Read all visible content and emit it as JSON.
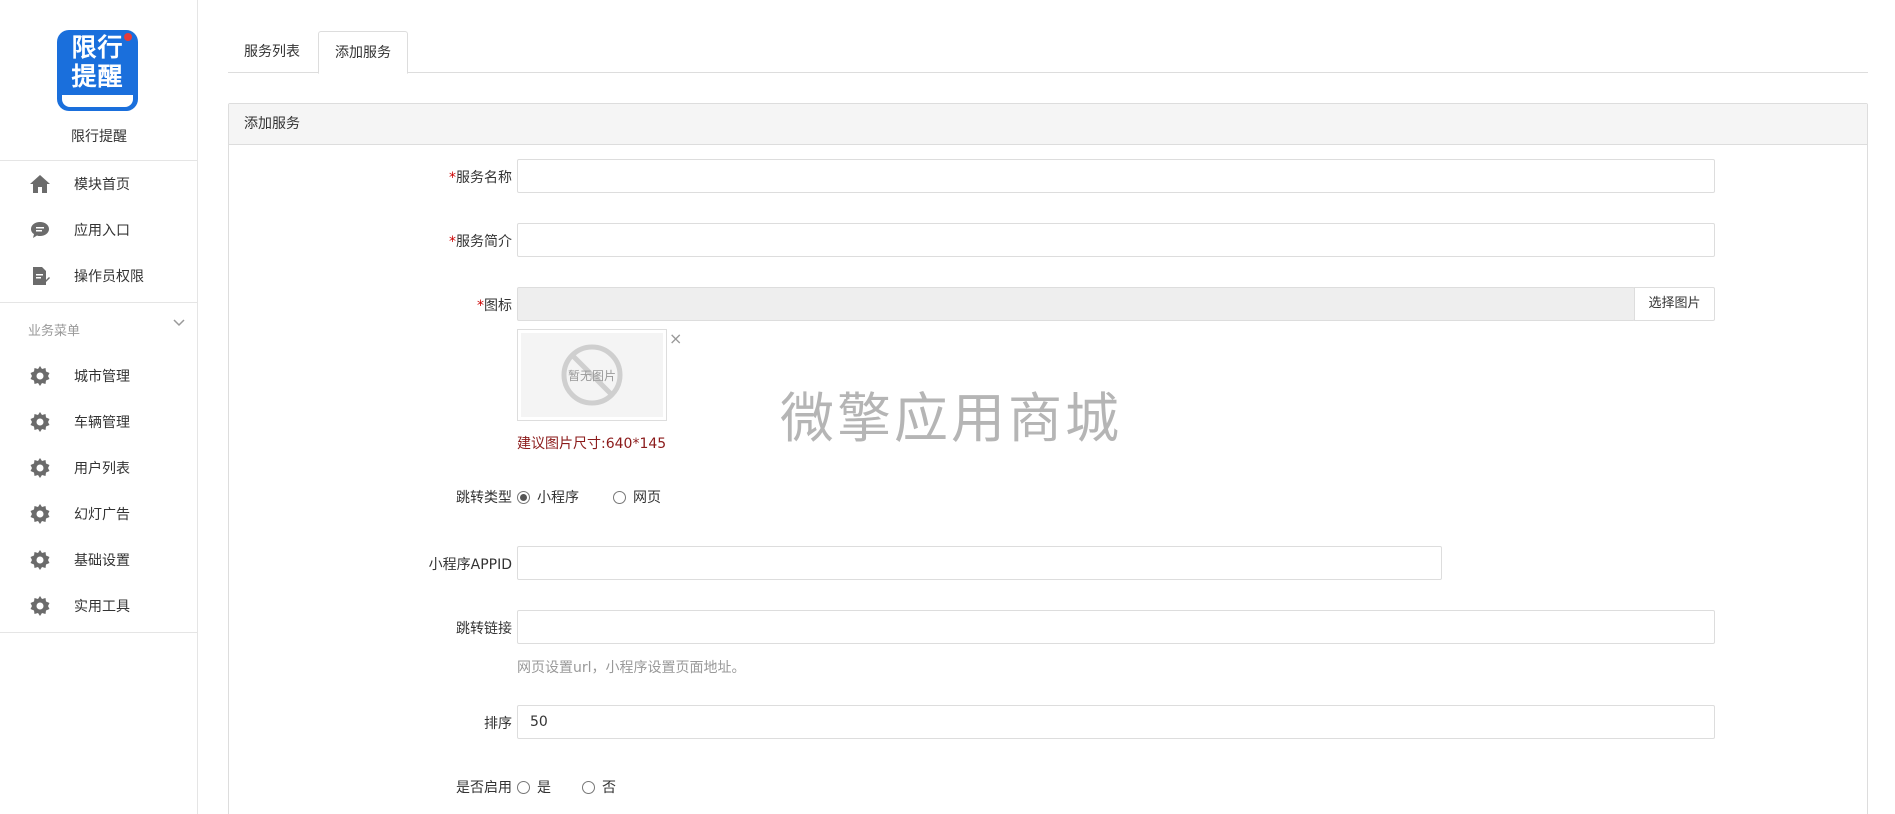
{
  "app": {
    "name": "限行提醒",
    "logo_line1": "限行",
    "logo_line2": "提醒"
  },
  "sidebar": {
    "top_items": [
      {
        "label": "模块首页",
        "icon": "home-icon"
      },
      {
        "label": "应用入口",
        "icon": "chat-bubble-icon"
      },
      {
        "label": "操作员权限",
        "icon": "document-edit-icon"
      }
    ],
    "group_title": "业务菜单",
    "group_items": [
      {
        "label": "城市管理",
        "icon": "gear-icon"
      },
      {
        "label": "车辆管理",
        "icon": "gear-icon"
      },
      {
        "label": "用户列表",
        "icon": "gear-icon"
      },
      {
        "label": "幻灯广告",
        "icon": "gear-icon"
      },
      {
        "label": "基础设置",
        "icon": "gear-icon"
      },
      {
        "label": "实用工具",
        "icon": "gear-icon"
      }
    ]
  },
  "tabs": [
    {
      "label": "服务列表",
      "active": false
    },
    {
      "label": "添加服务",
      "active": true
    }
  ],
  "panel": {
    "title": "添加服务"
  },
  "form": {
    "service_name": {
      "label": "服务名称",
      "required": true,
      "value": ""
    },
    "service_intro": {
      "label": "服务简介",
      "required": true,
      "value": ""
    },
    "icon": {
      "label": "图标",
      "required": true,
      "value": "",
      "button": "选择图片",
      "no_image": "暂无图片",
      "hint": "建议图片尺寸:640*145"
    },
    "jump_type": {
      "label": "跳转类型",
      "options": [
        "小程序",
        "网页"
      ],
      "selected": "小程序"
    },
    "appid": {
      "label": "小程序APPID",
      "value": ""
    },
    "jump_link": {
      "label": "跳转链接",
      "value": "",
      "hint": "网页设置url，小程序设置页面地址。"
    },
    "sort": {
      "label": "排序",
      "value": "50"
    },
    "enabled": {
      "label": "是否启用",
      "options": [
        "是",
        "否"
      ],
      "selected": ""
    }
  },
  "watermark": "微擎应用商城",
  "colors": {
    "logo_blue": "#1a6fdc",
    "required_red": "#cc0000",
    "hint_red": "#8b1a1a",
    "border": "#dddddd"
  }
}
